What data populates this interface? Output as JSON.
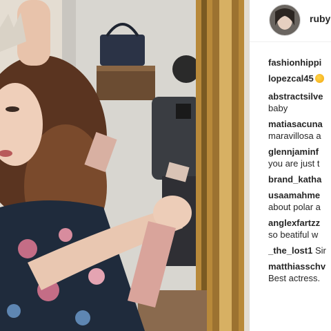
{
  "post": {
    "username": "ruby",
    "photo_alt": "photo"
  },
  "comments": [
    {
      "user": "fashionhippi",
      "text": ""
    },
    {
      "user": "lopezcal45",
      "text": "",
      "emoji": "face-emoji"
    },
    {
      "user": "abstractsilve",
      "text": "baby"
    },
    {
      "user": "matiasacuna",
      "text": "maravillosa a"
    },
    {
      "user": "glennjaminf",
      "text": "you are just t"
    },
    {
      "user": "brand_katha",
      "text": ""
    },
    {
      "user": "usaamahme",
      "text": "about polar a"
    },
    {
      "user": "anglexfartzz",
      "text": "so beatiful w"
    },
    {
      "user": "_the_lost1",
      "text": "Sir"
    },
    {
      "user": "matthiasschv",
      "text": "Best actress."
    }
  ],
  "colors": {
    "text": "#262626",
    "frame_gold": "#b8893a",
    "divider": "#dbdbdb"
  }
}
